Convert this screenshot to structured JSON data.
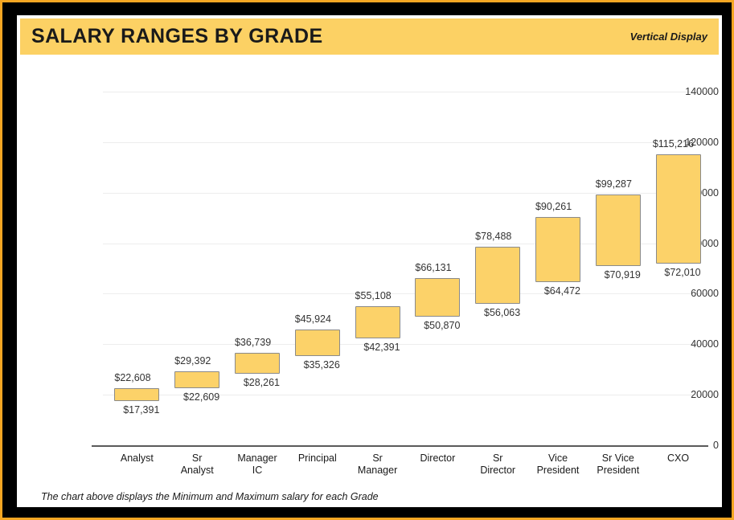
{
  "window": {
    "title": "SALARY RANGES BY GRADE",
    "display_mode": "Vertical Display",
    "footnote": "The chart above displays the Minimum and Maximum salary for each Grade",
    "colors": {
      "accent": "#fcd164",
      "bar_fill": "#fcd269",
      "bar_border": "#8a8a8a",
      "frame": "#000000",
      "outer_edge": "#f5a623",
      "gridline": "#ededed",
      "axis": "#5a5a5a",
      "paper": "#ffffff"
    }
  },
  "chart_data": {
    "type": "bar",
    "title": "SALARY RANGES BY GRADE",
    "subtitle": "Vertical Display",
    "xlabel": "",
    "ylabel": "",
    "ylim": [
      0,
      140000
    ],
    "ytick_values": [
      0,
      20000,
      40000,
      60000,
      80000,
      100000,
      120000,
      140000
    ],
    "ytick_labels": [
      "0",
      "20000",
      "40000",
      "60000",
      "80000",
      "100000",
      "120000",
      "140000"
    ],
    "grid": true,
    "legend": false,
    "orientation": "vertical",
    "note": "Floating range (min-max) bars; each bar spans from Minimum to Maximum salary.",
    "categories": [
      "Analyst",
      "Sr Analyst",
      "Manager IC",
      "Principal",
      "Sr Manager",
      "Director",
      "Sr Director",
      "Vice President",
      "Sr Vice President",
      "CXO"
    ],
    "category_display": [
      "Analyst",
      "Sr Analyst",
      "Manager IC",
      "Principal",
      "Sr Manager",
      "Director",
      "Sr Director",
      "Vice\nPresident",
      "Sr Vice\nPresident",
      "CXO"
    ],
    "series": [
      {
        "name": "Minimum",
        "values": [
          17391,
          22609,
          28261,
          35326,
          42391,
          50870,
          56063,
          64472,
          70919,
          72010
        ]
      },
      {
        "name": "Maximum",
        "values": [
          22608,
          29392,
          36739,
          45924,
          55108,
          66131,
          78488,
          90261,
          99287,
          115216
        ]
      }
    ],
    "min_labels": [
      "$17,391",
      "$22,609",
      "$28,261",
      "$35,326",
      "$42,391",
      "$50,870",
      "$56,063",
      "$64,472",
      "$70,919",
      "$72,010"
    ],
    "max_labels": [
      "$22,608",
      "$29,392",
      "$36,739",
      "$45,924",
      "$55,108",
      "$66,131",
      "$78,488",
      "$90,261",
      "$99,287",
      "$115,216"
    ]
  }
}
